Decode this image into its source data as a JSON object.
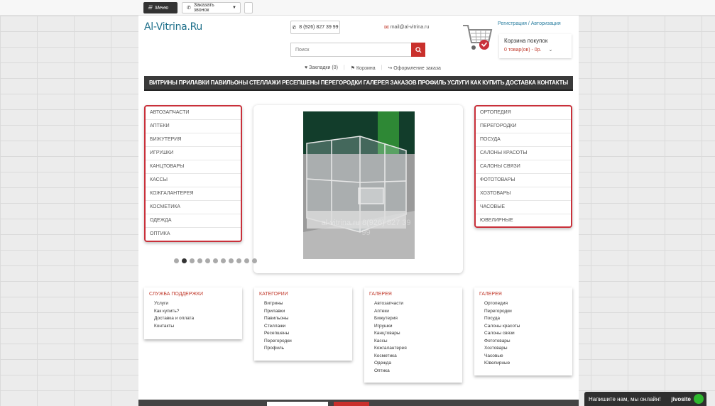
{
  "topbar": {
    "menu_label": "Меню",
    "call_label": "Заказать звонок"
  },
  "header": {
    "logo": "Al-Vitrina.Ru",
    "phone": "8 (926) 827 39 99",
    "email": "mail@al-vitrina.ru",
    "search_placeholder": "Поиск",
    "links": [
      "Закладки (0)",
      "Корзина",
      "Оформление заказа"
    ],
    "reg_link": "Регистрация / Авторизация",
    "cart_title": "Корзина покупок",
    "cart_summary": "0 товар(ов) - 0р."
  },
  "nav": [
    "ВИТРИНЫ",
    "ПРИЛАВКИ",
    "ПАВИЛЬОНЫ",
    "СТЕЛЛАЖИ",
    "РЕСЕПШЕНЫ",
    "ПЕРЕГОРОДКИ",
    "ГАЛЕРЕЯ ЗАКАЗОВ",
    "ПРОФИЛЬ",
    "УСЛУГИ",
    "КАК КУПИТЬ",
    "ДОСТАВКА",
    "КОНТАКТЫ"
  ],
  "left_list": [
    "Автозапчасти",
    "Аптеки",
    "Бижутерия",
    "Игрушки",
    "Канцтовары",
    "Кассы",
    "Кожгалантерея",
    "Косметика",
    "Одежда",
    "Оптика"
  ],
  "right_list": [
    "Ортопедия",
    "Перегородки",
    "Посуда",
    "Салоны красоты",
    "Салоны связи",
    "Фототовары",
    "Хозтовары",
    "Часовые",
    "Ювелирные"
  ],
  "slider": {
    "watermark": "al-vitrina.ru 8(926) 827 39 99",
    "dot_count": 11,
    "active_index": 1
  },
  "footer": {
    "support": {
      "title": "Служба поддержки",
      "items": [
        "Услуги",
        "Как купить?",
        "Доставка и оплата",
        "Контакты"
      ]
    },
    "categories": {
      "title": "Категории",
      "items": [
        "Витрины",
        "Прилавки",
        "Павильоны",
        "Стеллажи",
        "Ресепшены",
        "Перегородки",
        "Профиль"
      ]
    },
    "gallery1": {
      "title": "Галерея",
      "items": [
        "Автозапчасти",
        "Аптеки",
        "Бижутерия",
        "Игрушки",
        "Канцтовары",
        "Кассы",
        "Кожгалантерея",
        "Косметика",
        "Одежда",
        "Оптика"
      ]
    },
    "gallery2": {
      "title": "Галерея",
      "items": [
        "Ортопедия",
        "Перегородки",
        "Посуда",
        "Салоны красоты",
        "Салоны связи",
        "Фототовары",
        "Хозтовары",
        "Часовые",
        "Ювелирные"
      ]
    }
  },
  "chat": {
    "label": "Напишите нам, мы онлайн!",
    "brand": "jivosite"
  },
  "colors": {
    "accent": "#c9303a",
    "logo": "#1d6f8a",
    "nav_bg": "#3a3a3a"
  }
}
